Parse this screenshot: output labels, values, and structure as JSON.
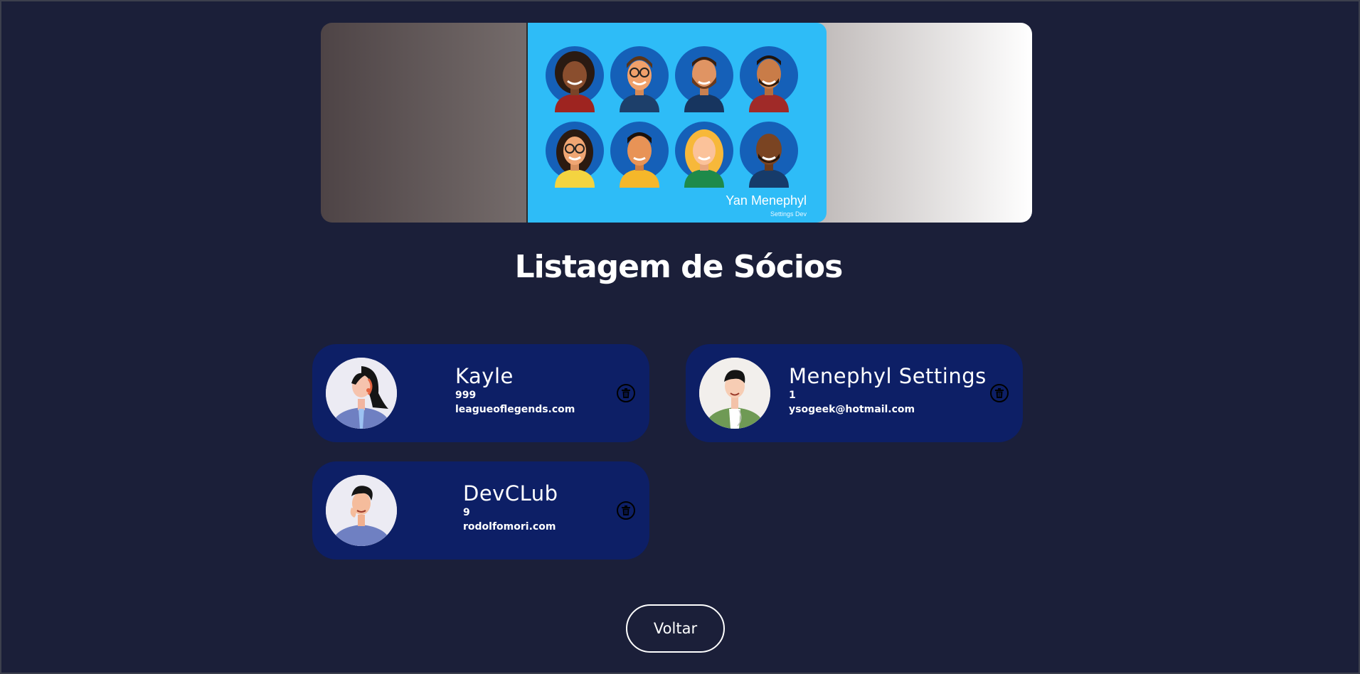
{
  "banner": {
    "name": "Yan Menephyl",
    "subtitle": "Settings Dev"
  },
  "page": {
    "title": "Listagem de Sócios"
  },
  "members": [
    {
      "name": "Kayle",
      "number": "999",
      "email": "leagueoflegends.com"
    },
    {
      "name": "Menephyl Settings",
      "number": "1",
      "email": "ysogeek@hotmail.com"
    },
    {
      "name": "DevCLub",
      "number": "9",
      "email": "rodolfomori.com"
    }
  ],
  "actions": {
    "back_label": "Voltar"
  },
  "colors": {
    "background": "#1b1f39",
    "card": "#0d1f66",
    "banner_card": "#2ebcf7",
    "text": "#ffffff"
  },
  "icons": {
    "delete": "trash-icon"
  }
}
